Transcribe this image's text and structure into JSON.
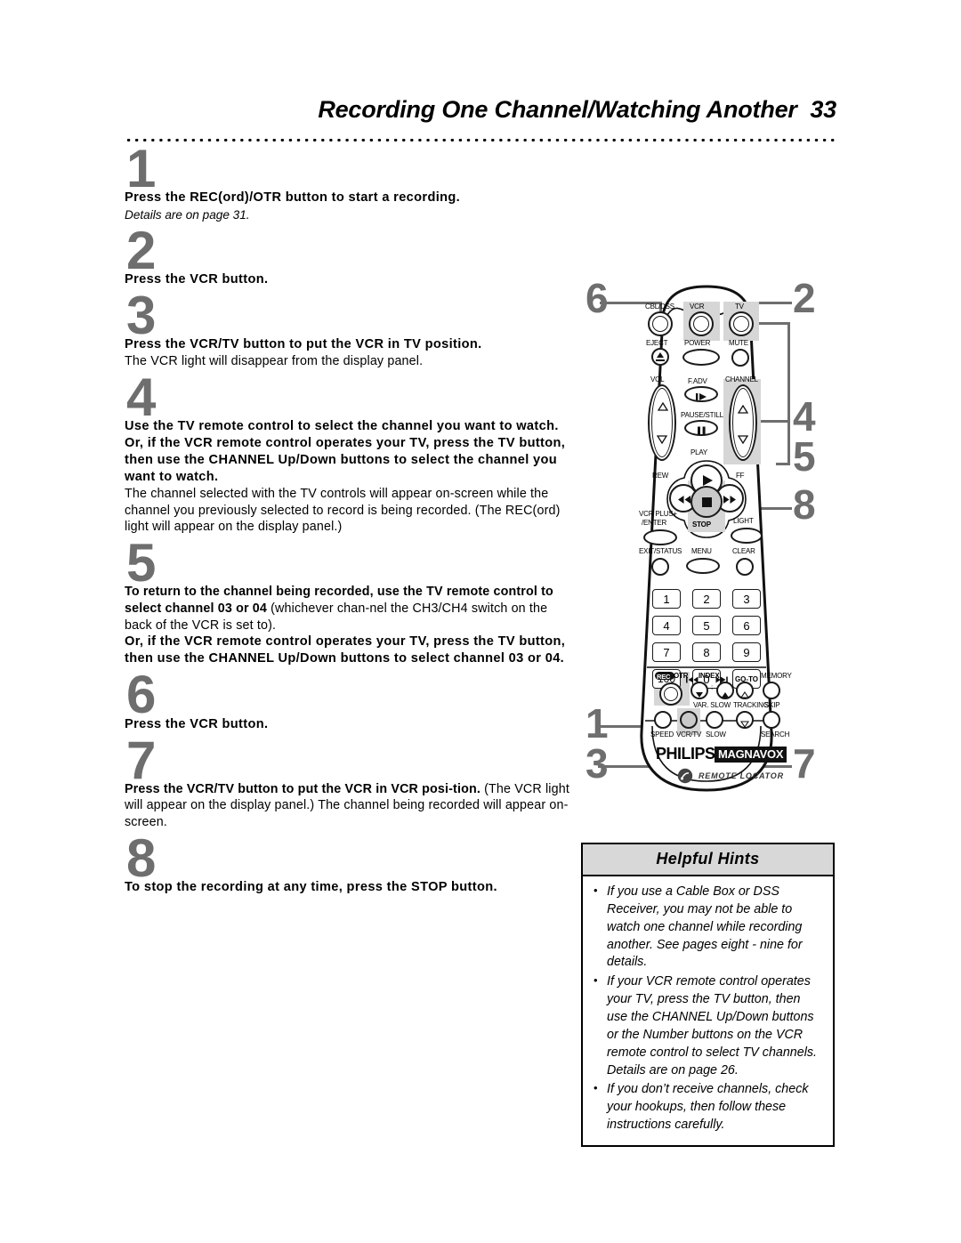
{
  "header": {
    "title": "Recording One Channel/Watching Another",
    "page_number": "33"
  },
  "steps": [
    {
      "num": "1",
      "title": "Press the REC(ord)/OTR button to start a recording.",
      "note": "Details are on page 31.",
      "body": ""
    },
    {
      "num": "2",
      "title": "Press the VCR button.",
      "note": "",
      "body": ""
    },
    {
      "num": "3",
      "title": "Press the VCR/TV button to put the VCR in TV position.",
      "note": "",
      "body": "The VCR light will disappear from the display panel."
    },
    {
      "num": "4",
      "title": "Use the TV remote control to select the channel you want to watch. Or, if the VCR remote control operates your TV, press the TV button, then use the CHANNEL Up/Down buttons to select the channel you want to watch.",
      "note": "",
      "body": "The channel selected with the TV controls will appear on-screen while the channel you previously selected to record is being recorded. (The REC(ord) light will appear on the display panel.)"
    },
    {
      "num": "5",
      "title_a": "To return to the channel being recorded, use the TV remote control to select channel 03 or 04",
      "body_a": " (whichever chan-nel the CH3/CH4 switch on the back of the VCR is set to).",
      "title_b": "Or, if the VCR remote control operates your TV, press the TV button, then use the CHANNEL Up/Down buttons to select channel 03 or 04.",
      "num_only": false
    },
    {
      "num": "6",
      "title": "Press the VCR button.",
      "note": "",
      "body": ""
    },
    {
      "num": "7",
      "title_a": "Press the VCR/TV button to put the VCR in VCR posi-tion.",
      "body_a": " (The VCR light will appear on the display panel.) The channel being recorded will appear on-screen."
    },
    {
      "num": "8",
      "title": "To stop the recording at any time, press the STOP button.",
      "note": "",
      "body": ""
    }
  ],
  "callouts": {
    "c6": "6",
    "c2": "2",
    "c4": "4",
    "c5": "5",
    "c8": "8",
    "c1": "1",
    "c3": "3",
    "c7": "7"
  },
  "remote": {
    "buttons": {
      "cbl_dss": "CBL/DSS",
      "vcr": "VCR",
      "tv": "TV",
      "eject": "EJECT",
      "power": "POWER",
      "mute": "MUTE",
      "vol": "VOL",
      "f_adv": "F.ADV",
      "channel": "CHANNEL",
      "pause_still": "PAUSE/STILL",
      "play": "PLAY",
      "rew": "REW",
      "ff": "FF",
      "vcr_plus_enter_1": "VCR PLUS+",
      "vcr_plus_enter_2": "/ENTER",
      "stop": "STOP",
      "light": "LIGHT",
      "exit_status": "EXIT/STATUS",
      "menu": "MENU",
      "clear": "CLEAR",
      "rec_otr": "REC",
      "otr": "OTR",
      "index": "INDEX",
      "memory": "MEMORY",
      "var_slow": "VAR. SLOW",
      "tracking": "TRACKING",
      "skip": "SKIP",
      "speed": "SPEED",
      "vcr_tv": "VCR/TV",
      "slow": "SLOW",
      "search": "SEARCH"
    },
    "numeric_keys": [
      "1",
      "2",
      "3",
      "4",
      "5",
      "6",
      "7",
      "8",
      "9",
      "100",
      "0",
      "GO-TO"
    ],
    "brand_philips": "PHILIPS",
    "brand_magnavox": "MAGNAVOX",
    "remote_locator": "REMOTE LOCATOR"
  },
  "hints": {
    "title": "Helpful Hints",
    "items": [
      "If you use a Cable Box or DSS Receiver, you may not be able to watch one channel while recording another. See pages eight - nine for details.",
      "If your VCR remote control operates your TV, press the TV button, then use the CHANNEL Up/Down buttons or the Number buttons on the VCR remote control to select TV channels. Details are on page 26.",
      "If you don’t receive channels, check your hookups, then follow these instructions carefully."
    ]
  },
  "colors": {
    "callout_gray": "#6e6e6e",
    "highlight_gray": "#d6d6d6",
    "hints_header_gray": "#d8d8d8"
  }
}
